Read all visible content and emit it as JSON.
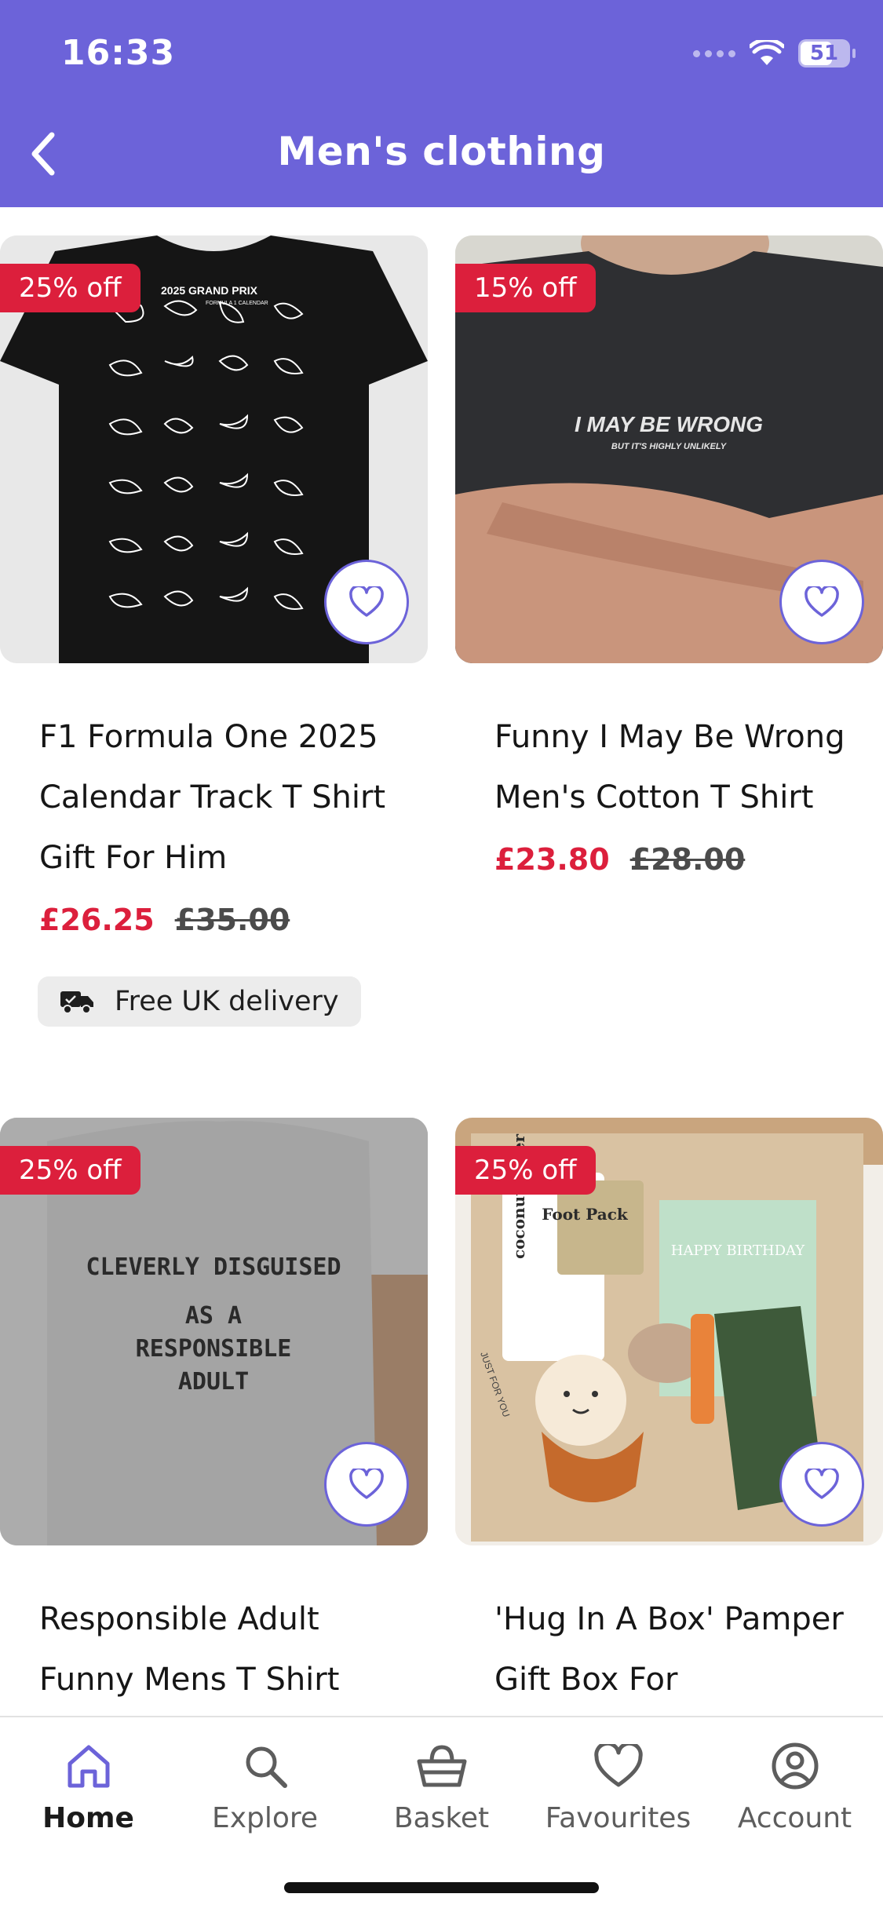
{
  "status_bar": {
    "time": "16:33",
    "battery": "51"
  },
  "header": {
    "title": "Men's clothing",
    "back_icon": "chevron-left-icon"
  },
  "products": [
    {
      "badge": "25% off",
      "title": "F1 Formula One 2025 Calendar Track T Shirt Gift For Him",
      "price_now": "£26.25",
      "price_was": "£35.00",
      "delivery": "Free UK delivery",
      "image_text": {
        "line1": "2025 GRAND PRIX",
        "line2": "FORMULA 1 CALENDAR"
      }
    },
    {
      "badge": "15% off",
      "title": "Funny I May Be Wrong Men's Cotton T Shirt",
      "price_now": "£23.80",
      "price_was": "£28.00",
      "image_text": {
        "line1": "I MAY BE WRONG",
        "line2": "BUT IT'S HIGHLY UNLIKELY"
      }
    },
    {
      "badge": "25% off",
      "title": "Responsible Adult Funny Mens T Shirt",
      "image_text": {
        "line1": "CLEVERLY DISGUISED",
        "line2": "AS A",
        "line3": "RESPONSIBLE",
        "line4": "ADULT"
      }
    },
    {
      "badge": "25% off",
      "title": "'Hug In A Box' Pamper Gift Box For",
      "image_text": {
        "line1": "Foot Pack",
        "line2": "coconut water",
        "line3": "HAPPY BIRTHDAY",
        "line4": "JUST FOR YOU"
      }
    }
  ],
  "nav": {
    "items": [
      {
        "label": "Home",
        "icon": "home-icon"
      },
      {
        "label": "Explore",
        "icon": "search-icon"
      },
      {
        "label": "Basket",
        "icon": "basket-icon"
      },
      {
        "label": "Favourites",
        "icon": "heart-icon"
      },
      {
        "label": "Account",
        "icon": "account-icon"
      }
    ],
    "active": "Home"
  },
  "colors": {
    "brand": "#6c63d9",
    "sale": "#dc1f3c"
  }
}
